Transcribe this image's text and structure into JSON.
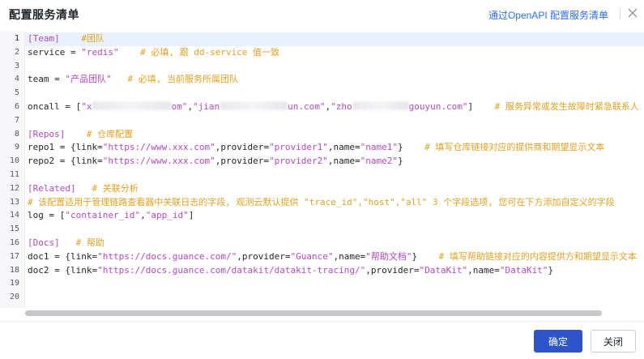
{
  "dialog": {
    "title": "配置服务清单",
    "header_link": "通过OpenAPI 配置服务清单",
    "close_icon": "close-icon"
  },
  "editor": {
    "line_numbers": [
      "1",
      "2",
      "3",
      "4",
      "5",
      "6",
      "7",
      "8",
      "9",
      "10",
      "11",
      "12",
      "13",
      "14",
      "15",
      "16",
      "17",
      "18",
      "19",
      "20"
    ],
    "lines": [
      [
        {
          "t": "sec",
          "v": "[Team]"
        },
        {
          "t": "cmt",
          "v": "    #团队"
        }
      ],
      [
        {
          "t": "txt",
          "v": "service = "
        },
        {
          "t": "str",
          "v": "\"redis\""
        },
        {
          "t": "cmt",
          "v": "    # 必填, 跟 dd-service 值一致"
        }
      ],
      [],
      [
        {
          "t": "txt",
          "v": "team = "
        },
        {
          "t": "str",
          "v": "\"产品团队\""
        },
        {
          "t": "cmt",
          "v": "   # 必填, 当前服务所属团队"
        }
      ],
      [],
      [
        {
          "t": "txt",
          "v": "oncall = ["
        },
        {
          "t": "str",
          "v": "\"x"
        },
        {
          "t": "blur",
          "w": 98
        },
        {
          "t": "str",
          "v": "om\""
        },
        {
          "t": "txt",
          "v": ","
        },
        {
          "t": "str",
          "v": "\"jian"
        },
        {
          "t": "blur",
          "w": 84
        },
        {
          "t": "str",
          "v": "un.com\""
        },
        {
          "t": "txt",
          "v": ","
        },
        {
          "t": "str",
          "v": "\"zho"
        },
        {
          "t": "blur",
          "w": 70
        },
        {
          "t": "str",
          "v": "gouyun.com\""
        },
        {
          "t": "txt",
          "v": "]"
        },
        {
          "t": "cmt",
          "v": "    # 服务异常或发生故障时紧急联系人"
        }
      ],
      [],
      [
        {
          "t": "sec",
          "v": "[Repos]"
        },
        {
          "t": "cmt",
          "v": "    # 仓库配置"
        }
      ],
      [
        {
          "t": "txt",
          "v": "repo1 = {link="
        },
        {
          "t": "str",
          "v": "\"https://www.xxx.com\""
        },
        {
          "t": "txt",
          "v": ",provider="
        },
        {
          "t": "str",
          "v": "\"provider1\""
        },
        {
          "t": "txt",
          "v": ",name="
        },
        {
          "t": "str",
          "v": "\"name1\""
        },
        {
          "t": "txt",
          "v": "}"
        },
        {
          "t": "cmt",
          "v": "    # 填写仓库链接对应的提供商和期望显示文本"
        }
      ],
      [
        {
          "t": "txt",
          "v": "repo2 = {link="
        },
        {
          "t": "str",
          "v": "\"https://www.xxx.com\""
        },
        {
          "t": "txt",
          "v": ",provider="
        },
        {
          "t": "str",
          "v": "\"provider2\""
        },
        {
          "t": "txt",
          "v": ",name="
        },
        {
          "t": "str",
          "v": "\"name2\""
        },
        {
          "t": "txt",
          "v": "}"
        }
      ],
      [],
      [
        {
          "t": "sec",
          "v": "[Related]"
        },
        {
          "t": "cmt",
          "v": "   # 关联分析"
        }
      ],
      [
        {
          "t": "cmt",
          "v": "# 该配置适用于管理链路查看器中关联日志的字段, 观测云默认提供 \"trace_id\",\"host\",\"all\" 3 个字段选项, 您可在下方添加自定义的字段"
        }
      ],
      [
        {
          "t": "txt",
          "v": "log = ["
        },
        {
          "t": "str",
          "v": "\"container_id\""
        },
        {
          "t": "txt",
          "v": ","
        },
        {
          "t": "str",
          "v": "\"app_id\""
        },
        {
          "t": "txt",
          "v": "]"
        }
      ],
      [],
      [
        {
          "t": "sec",
          "v": "[Docs]"
        },
        {
          "t": "cmt",
          "v": "   # 帮助"
        }
      ],
      [
        {
          "t": "txt",
          "v": "doc1 = {link="
        },
        {
          "t": "str",
          "v": "\"https://docs.guance.com/\""
        },
        {
          "t": "txt",
          "v": ",provider="
        },
        {
          "t": "str",
          "v": "\"Guance\""
        },
        {
          "t": "txt",
          "v": ",name="
        },
        {
          "t": "str",
          "v": "\"帮助文档\""
        },
        {
          "t": "txt",
          "v": "}"
        },
        {
          "t": "cmt",
          "v": "    # 填写帮助链接对应的内容提供方和期望显示文本"
        }
      ],
      [
        {
          "t": "txt",
          "v": "doc2 = {link="
        },
        {
          "t": "str",
          "v": "\"https://docs.guance.com/datakit/datakit-tracing/\""
        },
        {
          "t": "txt",
          "v": ",provider="
        },
        {
          "t": "str",
          "v": "\"DataKit\""
        },
        {
          "t": "txt",
          "v": ",name="
        },
        {
          "t": "str",
          "v": "\"DataKit\""
        },
        {
          "t": "txt",
          "v": "}"
        }
      ],
      [],
      []
    ]
  },
  "footer": {
    "ok_label": "确定",
    "close_label": "关闭"
  },
  "colors": {
    "section": "#b548c6",
    "comment": "#e5a021",
    "string": "#b548c6",
    "primary": "#2d54c8",
    "link": "#2d6df6"
  }
}
